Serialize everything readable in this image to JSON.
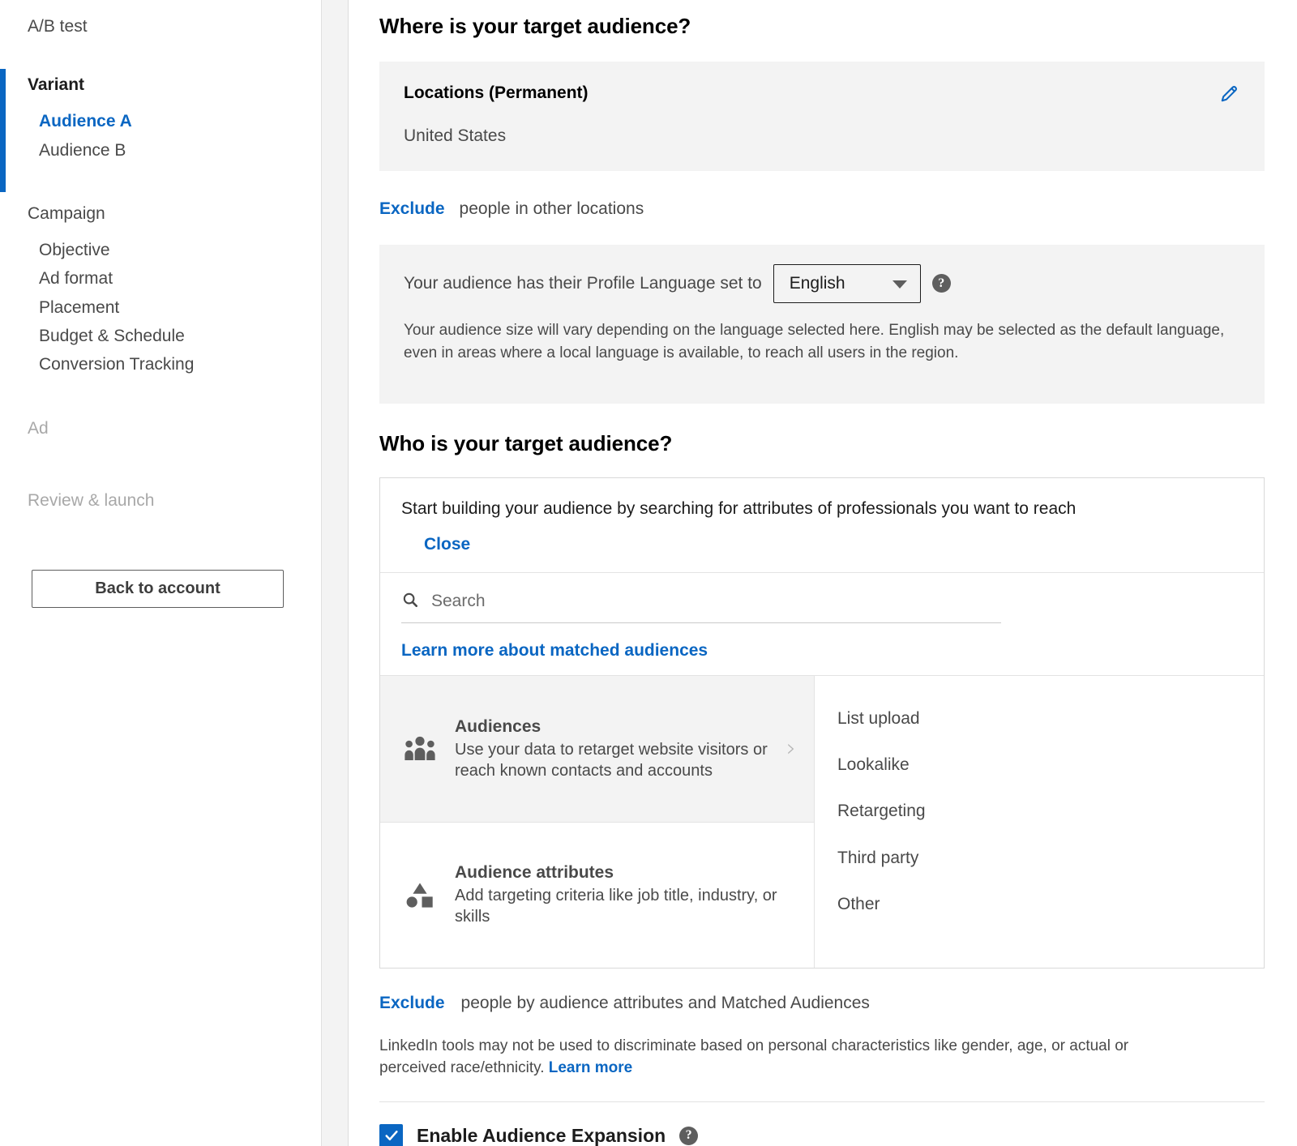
{
  "sidebar": {
    "top_item": "A/B test",
    "variant": {
      "title": "Variant",
      "items": [
        {
          "label": "Audience A",
          "active": true
        },
        {
          "label": "Audience B",
          "active": false
        }
      ]
    },
    "campaign": {
      "title": "Campaign",
      "items": [
        {
          "label": "Objective"
        },
        {
          "label": "Ad format"
        },
        {
          "label": "Placement"
        },
        {
          "label": "Budget & Schedule"
        },
        {
          "label": "Conversion Tracking"
        }
      ]
    },
    "ad_step": "Ad",
    "review_step": "Review & launch",
    "back_button": "Back to account"
  },
  "main": {
    "where_heading": "Where is your target audience?",
    "locations": {
      "title": "Locations (Permanent)",
      "value": "United States",
      "edit_icon": "pencil-icon"
    },
    "exclude_locations": {
      "link": "Exclude",
      "text": "people in other locations"
    },
    "language": {
      "label": "Your audience has their Profile Language set to",
      "selected": "English",
      "options": [
        "English"
      ],
      "help_glyph": "?",
      "note": "Your audience size will vary depending on the language selected here. English may be selected as the default language, even in areas where a local language is available, to reach all users in the region."
    },
    "who_heading": "Who is your target audience?",
    "panel": {
      "prompt": "Start building your audience by searching for attributes of professionals you want to reach",
      "close_label": "Close",
      "search_placeholder": "Search",
      "search_value": "",
      "search_icon": "search-icon",
      "learn_more_matched": "Learn more about matched audiences",
      "options": [
        {
          "title": "Audiences",
          "desc": "Use your data to retarget website visitors or reach known contacts and accounts",
          "icon": "people-group-icon",
          "selected": true,
          "chevron": "›"
        },
        {
          "title": "Audience attributes",
          "desc": "Add targeting criteria like job title, industry, or skills",
          "icon": "shapes-icon",
          "selected": false,
          "chevron": ""
        }
      ],
      "sub_options": [
        "List upload",
        "Lookalike",
        "Retargeting",
        "Third party",
        "Other"
      ]
    },
    "exclude_attributes": {
      "link": "Exclude",
      "text": "people by audience attributes and Matched Audiences"
    },
    "disclaimer": {
      "text": "LinkedIn tools may not be used to discriminate based on personal characteristics like gender, age, or actual or perceived race/ethnicity. ",
      "link": "Learn more"
    },
    "audience_expansion": {
      "label": "Enable Audience Expansion",
      "checked": true,
      "help_glyph": "?"
    }
  },
  "colors": {
    "accent": "#0a66c2",
    "text": "#494949",
    "heading": "#000000",
    "panel_bg": "#f3f3f3"
  }
}
